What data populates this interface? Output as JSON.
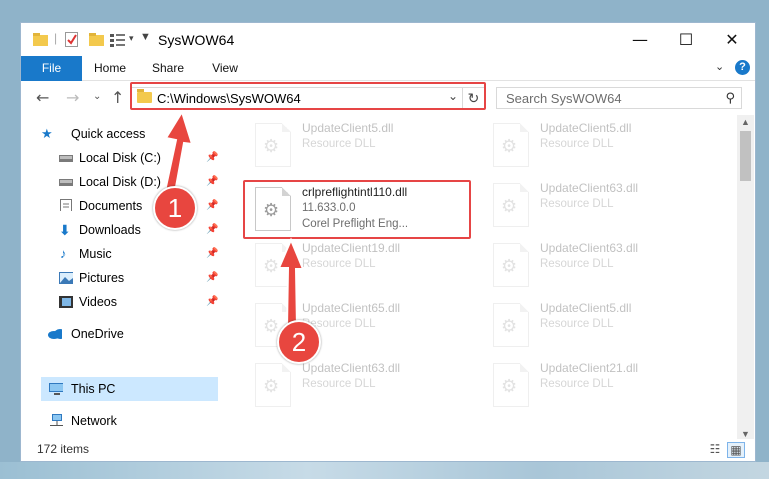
{
  "window": {
    "title": "SysWOW64",
    "controls": {
      "minimize": "—",
      "maximize": "☐",
      "close": "✕"
    }
  },
  "ribbon": {
    "tabs": [
      "File",
      "Home",
      "Share",
      "View"
    ],
    "help": "?"
  },
  "address": {
    "path": "C:\\Windows\\SysWOW64",
    "search_placeholder": "Search SysWOW64"
  },
  "nav": {
    "quick_access": "Quick access",
    "items": [
      {
        "label": "Local Disk (C:)",
        "icon": "drive-icon",
        "pinned": true
      },
      {
        "label": "Local Disk (D:)",
        "icon": "drive-icon",
        "pinned": true
      },
      {
        "label": "Documents",
        "icon": "documents-icon",
        "pinned": true
      },
      {
        "label": "Downloads",
        "icon": "downloads-icon",
        "pinned": true
      },
      {
        "label": "Music",
        "icon": "music-icon",
        "pinned": true
      },
      {
        "label": "Pictures",
        "icon": "pictures-icon",
        "pinned": true
      },
      {
        "label": "Videos",
        "icon": "videos-icon",
        "pinned": true
      }
    ],
    "onedrive": "OneDrive",
    "this_pc": "This PC",
    "network": "Network"
  },
  "files": [
    {
      "name": "UpdateClient5.dll",
      "desc": "Resource DLL"
    },
    {
      "name": "UpdateClient5.dll",
      "desc": "Resource DLL"
    },
    {
      "name": "crlpreflightintl110.dll",
      "version": "11.633.0.0",
      "desc": "Corel Preflight Eng..."
    },
    {
      "name": "UpdateClient63.dll",
      "desc": "Resource DLL"
    },
    {
      "name": "UpdateClient19.dll",
      "desc": "Resource DLL"
    },
    {
      "name": "UpdateClient63.dll",
      "desc": "Resource DLL"
    },
    {
      "name": "UpdateClient65.dll",
      "desc": "Resource DLL"
    },
    {
      "name": "UpdateClient5.dll",
      "desc": "Resource DLL"
    },
    {
      "name": "UpdateClient63.dll",
      "desc": "Resource DLL"
    },
    {
      "name": "UpdateClient21.dll",
      "desc": "Resource DLL"
    }
  ],
  "status": {
    "count": "172 items"
  },
  "annotations": {
    "step1": "1",
    "step2": "2"
  },
  "colors": {
    "accent": "#1979ca",
    "highlight": "#e64545",
    "selection": "#cce8ff"
  }
}
